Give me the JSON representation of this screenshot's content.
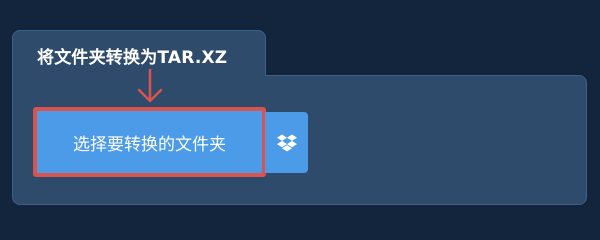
{
  "converter": {
    "title": "将文件夹转换为TAR.XZ",
    "choose_button_label": "选择要转换的文件夹",
    "dropbox_icon": "dropbox-icon",
    "highlight_color": "#d9534f",
    "button_color": "#4c9be8",
    "card_color": "#2e4b6c",
    "background_color": "#12253c"
  }
}
